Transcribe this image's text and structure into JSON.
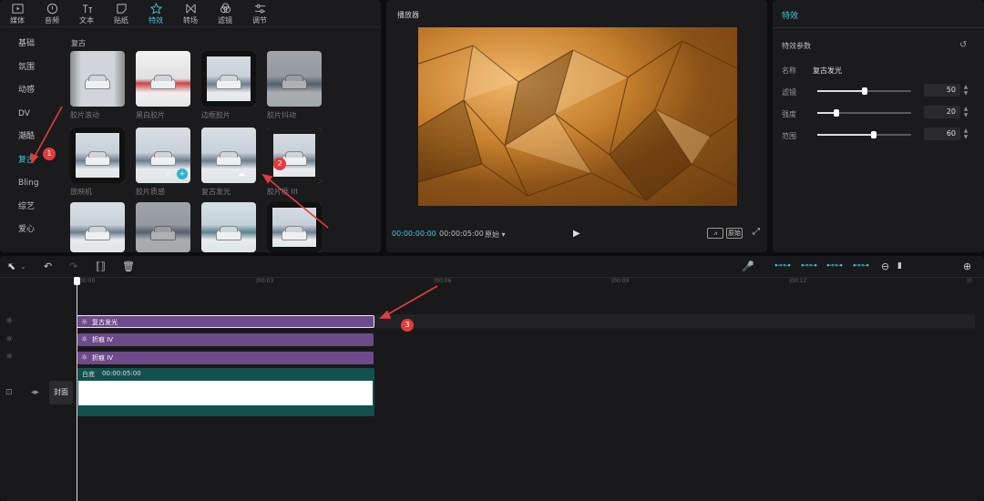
{
  "top_tabs": [
    {
      "label": "媒体",
      "icon": "media-icon"
    },
    {
      "label": "音频",
      "icon": "audio-icon"
    },
    {
      "label": "文本",
      "icon": "text-icon"
    },
    {
      "label": "贴纸",
      "icon": "sticker-icon"
    },
    {
      "label": "特效",
      "icon": "effects-icon",
      "active": true
    },
    {
      "label": "转场",
      "icon": "transition-icon"
    },
    {
      "label": "滤镜",
      "icon": "filter-icon"
    },
    {
      "label": "调节",
      "icon": "adjust-icon"
    }
  ],
  "categories": [
    "基础",
    "氛围",
    "动感",
    "DV",
    "潮酷",
    "复古",
    "Bling",
    "综艺",
    "爱心"
  ],
  "active_category": "复古",
  "section_title": "复古",
  "effects": [
    "胶片滚动",
    "黑白胶片",
    "边框胶片",
    "胶片抖动",
    "放映机",
    "胶片质感",
    "复古发光",
    "胶片框 III",
    "",
    "",
    "",
    ""
  ],
  "player": {
    "label": "播放器",
    "time_current": "00:00:00:00",
    "time_total": "00:00:05:00",
    "ratio_label": "原始",
    "btn_original": "原始"
  },
  "props": {
    "tab": "特效",
    "section": "特效参数",
    "name_label": "名称",
    "name_value": "复古发光",
    "params": [
      {
        "label": "滤镜",
        "value": "50"
      },
      {
        "label": "强度",
        "value": "20"
      },
      {
        "label": "范围",
        "value": "60"
      }
    ]
  },
  "ruler": [
    "00:00",
    "|00:03",
    "|00:06",
    "|00:09",
    "|00:12",
    "|0"
  ],
  "tracks": [
    {
      "label": "复古发光"
    },
    {
      "label": "折痕 IV"
    },
    {
      "label": "折痕 IV"
    }
  ],
  "main_clip": {
    "label": "白底",
    "duration": "00:00:05:00"
  },
  "cover_label": "封面",
  "annotations": [
    "1",
    "2",
    "3"
  ],
  "colors": {
    "accent": "#3ec6d6",
    "effect_track": "#6d4a8a",
    "main_track": "#135050",
    "annotation": "#e23c3c"
  }
}
